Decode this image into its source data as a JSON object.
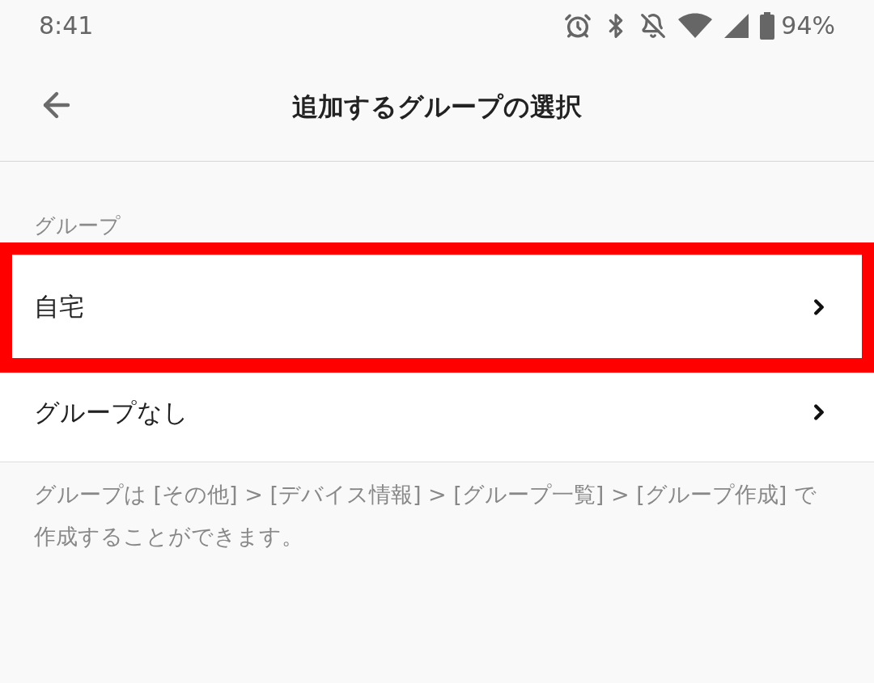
{
  "status_bar": {
    "time": "8:41",
    "battery": "94%"
  },
  "app_bar": {
    "title": "追加するグループの選択"
  },
  "groups": {
    "header": "グループ",
    "items": [
      {
        "label": "自宅",
        "highlighted": true
      },
      {
        "label": "グループなし",
        "highlighted": false
      }
    ]
  },
  "footer_note": "グループは [その他] > [デバイス情報] > [グループ一覧] > [グループ作成] で作成することができます。"
}
